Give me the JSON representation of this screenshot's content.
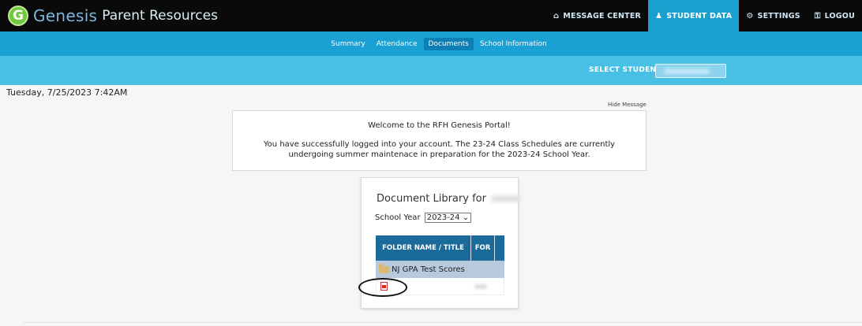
{
  "app": {
    "logo_letter": "G",
    "brand_name": "Genesis",
    "brand_suffix": "Parent Resources"
  },
  "top_nav": {
    "items": [
      {
        "label": "MESSAGE CENTER",
        "icon": "home-icon",
        "active": false
      },
      {
        "label": "STUDENT DATA",
        "icon": "users-icon",
        "active": true
      },
      {
        "label": "SETTINGS",
        "icon": "gear-icon",
        "active": false
      },
      {
        "label": "LOGOU",
        "icon": "lock-icon",
        "active": false
      }
    ]
  },
  "sub_nav": {
    "items": [
      "Summary",
      "Attendance",
      "Documents",
      "School Information"
    ],
    "active": "Documents"
  },
  "student_select": {
    "label": "SELECT STUDENT:"
  },
  "datetime": "Tuesday, 7/25/2023 7:42AM",
  "message": {
    "hide_label": "Hide Message",
    "title": "Welcome to the RFH Genesis Portal!",
    "body": "You have successfully logged into your account.  The 23-24 Class Schedules are currently undergoing summer maintenace in preparation for the 2023-24 School Year."
  },
  "document_library": {
    "title": "Document Library for",
    "year_label": "School Year",
    "year_value": "2023-24",
    "columns": [
      "FOLDER NAME / TITLE",
      "FOR"
    ],
    "rows": [
      {
        "name": "NJ GPA Test Scores",
        "type": "folder"
      },
      {
        "name": "",
        "type": "pdf"
      }
    ]
  },
  "colors": {
    "topbar": "#0a0a0a",
    "subnav": "#1aa0d2",
    "studentbar": "#48c0e6",
    "table_header": "#1a6a9a",
    "brand_green": "#6fc93b"
  }
}
